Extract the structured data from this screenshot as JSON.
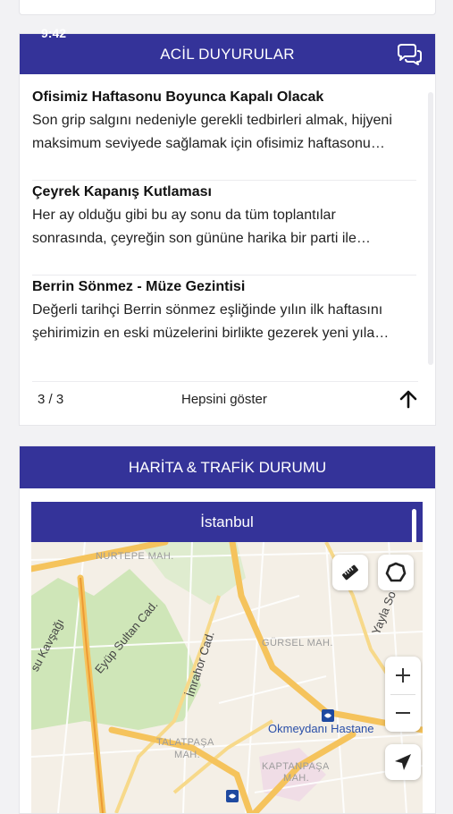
{
  "status_bar": {
    "time": "9:42"
  },
  "announcements": {
    "header_title": "ACİL DUYURULAR",
    "items": [
      {
        "title": "Ofisimiz Haftasonu Boyunca Kapalı Olacak",
        "body": "Son grip salgını nedeniyle gerekli tedbirleri almak, hijyeni\nmaksimum seviyede sağlamak için ofisimiz haftasonu…"
      },
      {
        "title": "Çeyrek Kapanış Kutlaması",
        "body": "Her ay olduğu gibi bu ay sonu da tüm toplantılar\nsonrasında, çeyreğin son gününe harika bir parti ile…"
      },
      {
        "title": "Berrin Sönmez - Müze Gezintisi",
        "body": "Değerli tarihçi Berrin sönmez eşliğinde yılın ilk haftasını\nşehirimizin en eski müzelerini birlikte gezerek yeni yıla…"
      }
    ],
    "pager": "3 / 3",
    "show_all_label": "Hepsini göster"
  },
  "map_section": {
    "header_title": "HARİTA & TRAFİK DURUMU",
    "city": "İstanbul",
    "labels": {
      "nurtepe": "NURTEPE MAH.",
      "gursel": "GÜRSEL MAH.",
      "talatpasa_1": "TALATPAŞA",
      "talatpasa_2": "MAH.",
      "kaptanpasa_1": "KAPTANPAŞA",
      "kaptanpasa_2": "MAH.",
      "eyup_sultan": "Eyüp Sultan Cad.",
      "imrahor": "İmrahor Cad.",
      "kavsagi": "su Kavşağı",
      "yayla": "Yayla So",
      "hospital": "Okmeydanı Hastane"
    }
  },
  "colors": {
    "brand": "#343399",
    "map_road_major": "#f5c35c",
    "map_green": "#cfe6b8"
  }
}
